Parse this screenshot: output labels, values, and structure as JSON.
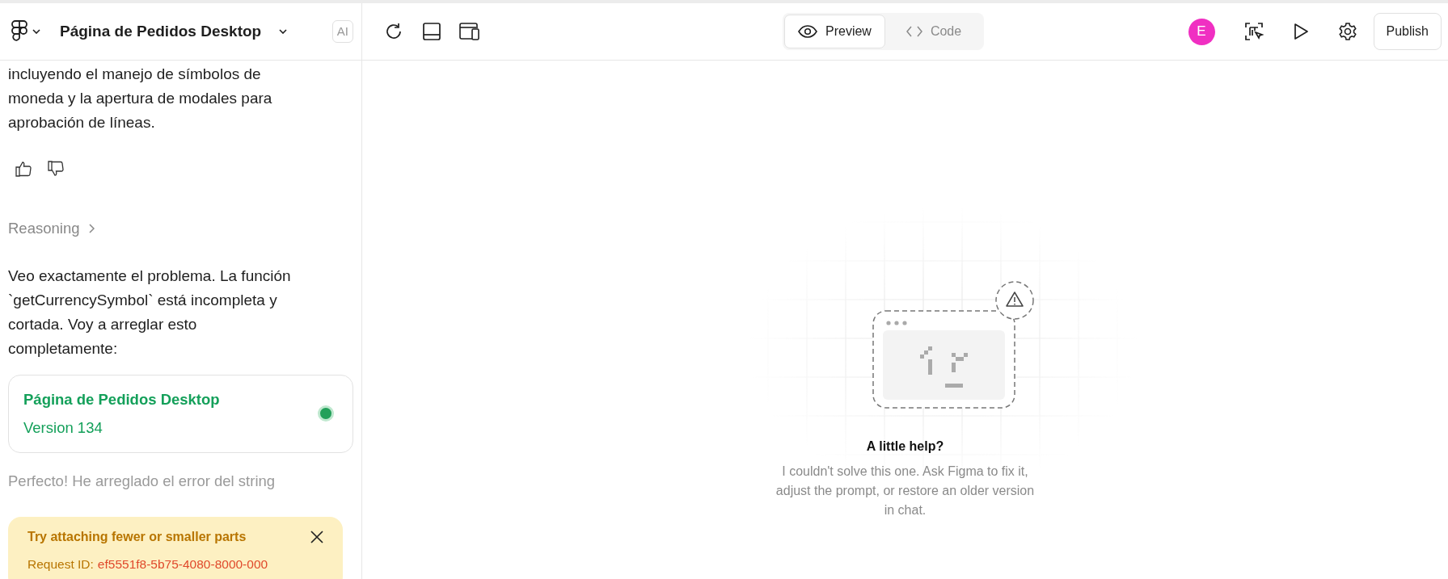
{
  "header": {
    "project_title": "Página de Pedidos Desktop",
    "ai_badge": "AI",
    "view_tabs": [
      {
        "label": "Preview",
        "kind": "preview",
        "selected": true
      },
      {
        "label": "Code",
        "kind": "code",
        "selected": false
      }
    ],
    "avatar_initial": "E",
    "publish_label": "Publish"
  },
  "chat": {
    "intro_text": "incluyendo el manejo de símbolos de moneda y la apertura de modales para aprobación de líneas.",
    "reasoning_label": "Reasoning",
    "message": "Veo exactamente el problema. La función `getCurrencySymbol` está incompleta y cortada. Voy a arreglar esto completamente:",
    "version_card": {
      "title": "Página de Pedidos Desktop",
      "version": "Version 134",
      "color": "#22a05a"
    },
    "faded_message": "Perfecto! He arreglado el error del string",
    "toast": {
      "title": "Try attaching fewer or smaller parts",
      "request_label": "Request ID:",
      "request_id": "ef5551f8-5b75-4080-8000-000"
    }
  },
  "preview": {
    "title": "A little help?",
    "description": "I couldn't solve this one. Ask Figma to fix it, adjust the prompt, or restore an older version in chat."
  }
}
